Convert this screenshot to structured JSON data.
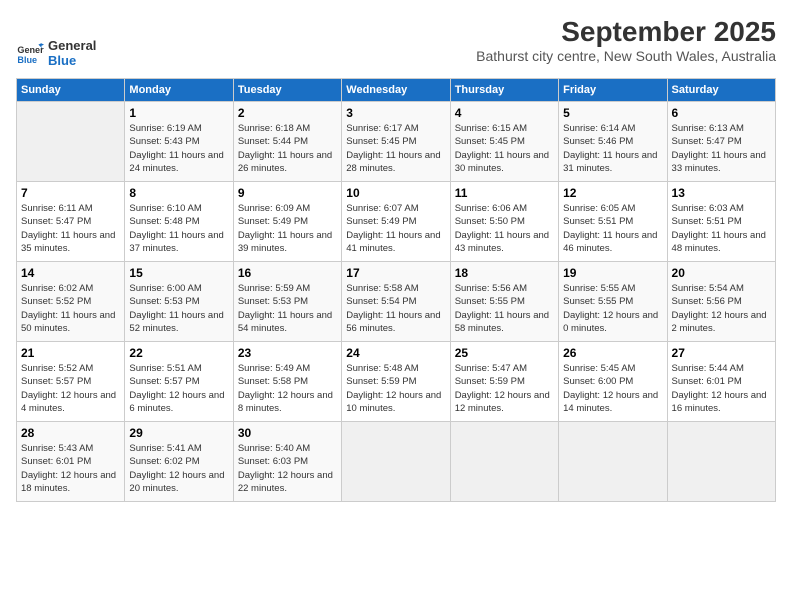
{
  "header": {
    "logo_line1": "General",
    "logo_line2": "Blue",
    "month": "September 2025",
    "location": "Bathurst city centre, New South Wales, Australia"
  },
  "weekdays": [
    "Sunday",
    "Monday",
    "Tuesday",
    "Wednesday",
    "Thursday",
    "Friday",
    "Saturday"
  ],
  "weeks": [
    [
      {
        "day": "",
        "sunrise": "",
        "sunset": "",
        "daylight": ""
      },
      {
        "day": "1",
        "sunrise": "Sunrise: 6:19 AM",
        "sunset": "Sunset: 5:43 PM",
        "daylight": "Daylight: 11 hours and 24 minutes."
      },
      {
        "day": "2",
        "sunrise": "Sunrise: 6:18 AM",
        "sunset": "Sunset: 5:44 PM",
        "daylight": "Daylight: 11 hours and 26 minutes."
      },
      {
        "day": "3",
        "sunrise": "Sunrise: 6:17 AM",
        "sunset": "Sunset: 5:45 PM",
        "daylight": "Daylight: 11 hours and 28 minutes."
      },
      {
        "day": "4",
        "sunrise": "Sunrise: 6:15 AM",
        "sunset": "Sunset: 5:45 PM",
        "daylight": "Daylight: 11 hours and 30 minutes."
      },
      {
        "day": "5",
        "sunrise": "Sunrise: 6:14 AM",
        "sunset": "Sunset: 5:46 PM",
        "daylight": "Daylight: 11 hours and 31 minutes."
      },
      {
        "day": "6",
        "sunrise": "Sunrise: 6:13 AM",
        "sunset": "Sunset: 5:47 PM",
        "daylight": "Daylight: 11 hours and 33 minutes."
      }
    ],
    [
      {
        "day": "7",
        "sunrise": "Sunrise: 6:11 AM",
        "sunset": "Sunset: 5:47 PM",
        "daylight": "Daylight: 11 hours and 35 minutes."
      },
      {
        "day": "8",
        "sunrise": "Sunrise: 6:10 AM",
        "sunset": "Sunset: 5:48 PM",
        "daylight": "Daylight: 11 hours and 37 minutes."
      },
      {
        "day": "9",
        "sunrise": "Sunrise: 6:09 AM",
        "sunset": "Sunset: 5:49 PM",
        "daylight": "Daylight: 11 hours and 39 minutes."
      },
      {
        "day": "10",
        "sunrise": "Sunrise: 6:07 AM",
        "sunset": "Sunset: 5:49 PM",
        "daylight": "Daylight: 11 hours and 41 minutes."
      },
      {
        "day": "11",
        "sunrise": "Sunrise: 6:06 AM",
        "sunset": "Sunset: 5:50 PM",
        "daylight": "Daylight: 11 hours and 43 minutes."
      },
      {
        "day": "12",
        "sunrise": "Sunrise: 6:05 AM",
        "sunset": "Sunset: 5:51 PM",
        "daylight": "Daylight: 11 hours and 46 minutes."
      },
      {
        "day": "13",
        "sunrise": "Sunrise: 6:03 AM",
        "sunset": "Sunset: 5:51 PM",
        "daylight": "Daylight: 11 hours and 48 minutes."
      }
    ],
    [
      {
        "day": "14",
        "sunrise": "Sunrise: 6:02 AM",
        "sunset": "Sunset: 5:52 PM",
        "daylight": "Daylight: 11 hours and 50 minutes."
      },
      {
        "day": "15",
        "sunrise": "Sunrise: 6:00 AM",
        "sunset": "Sunset: 5:53 PM",
        "daylight": "Daylight: 11 hours and 52 minutes."
      },
      {
        "day": "16",
        "sunrise": "Sunrise: 5:59 AM",
        "sunset": "Sunset: 5:53 PM",
        "daylight": "Daylight: 11 hours and 54 minutes."
      },
      {
        "day": "17",
        "sunrise": "Sunrise: 5:58 AM",
        "sunset": "Sunset: 5:54 PM",
        "daylight": "Daylight: 11 hours and 56 minutes."
      },
      {
        "day": "18",
        "sunrise": "Sunrise: 5:56 AM",
        "sunset": "Sunset: 5:55 PM",
        "daylight": "Daylight: 11 hours and 58 minutes."
      },
      {
        "day": "19",
        "sunrise": "Sunrise: 5:55 AM",
        "sunset": "Sunset: 5:55 PM",
        "daylight": "Daylight: 12 hours and 0 minutes."
      },
      {
        "day": "20",
        "sunrise": "Sunrise: 5:54 AM",
        "sunset": "Sunset: 5:56 PM",
        "daylight": "Daylight: 12 hours and 2 minutes."
      }
    ],
    [
      {
        "day": "21",
        "sunrise": "Sunrise: 5:52 AM",
        "sunset": "Sunset: 5:57 PM",
        "daylight": "Daylight: 12 hours and 4 minutes."
      },
      {
        "day": "22",
        "sunrise": "Sunrise: 5:51 AM",
        "sunset": "Sunset: 5:57 PM",
        "daylight": "Daylight: 12 hours and 6 minutes."
      },
      {
        "day": "23",
        "sunrise": "Sunrise: 5:49 AM",
        "sunset": "Sunset: 5:58 PM",
        "daylight": "Daylight: 12 hours and 8 minutes."
      },
      {
        "day": "24",
        "sunrise": "Sunrise: 5:48 AM",
        "sunset": "Sunset: 5:59 PM",
        "daylight": "Daylight: 12 hours and 10 minutes."
      },
      {
        "day": "25",
        "sunrise": "Sunrise: 5:47 AM",
        "sunset": "Sunset: 5:59 PM",
        "daylight": "Daylight: 12 hours and 12 minutes."
      },
      {
        "day": "26",
        "sunrise": "Sunrise: 5:45 AM",
        "sunset": "Sunset: 6:00 PM",
        "daylight": "Daylight: 12 hours and 14 minutes."
      },
      {
        "day": "27",
        "sunrise": "Sunrise: 5:44 AM",
        "sunset": "Sunset: 6:01 PM",
        "daylight": "Daylight: 12 hours and 16 minutes."
      }
    ],
    [
      {
        "day": "28",
        "sunrise": "Sunrise: 5:43 AM",
        "sunset": "Sunset: 6:01 PM",
        "daylight": "Daylight: 12 hours and 18 minutes."
      },
      {
        "day": "29",
        "sunrise": "Sunrise: 5:41 AM",
        "sunset": "Sunset: 6:02 PM",
        "daylight": "Daylight: 12 hours and 20 minutes."
      },
      {
        "day": "30",
        "sunrise": "Sunrise: 5:40 AM",
        "sunset": "Sunset: 6:03 PM",
        "daylight": "Daylight: 12 hours and 22 minutes."
      },
      {
        "day": "",
        "sunrise": "",
        "sunset": "",
        "daylight": ""
      },
      {
        "day": "",
        "sunrise": "",
        "sunset": "",
        "daylight": ""
      },
      {
        "day": "",
        "sunrise": "",
        "sunset": "",
        "daylight": ""
      },
      {
        "day": "",
        "sunrise": "",
        "sunset": "",
        "daylight": ""
      }
    ]
  ]
}
